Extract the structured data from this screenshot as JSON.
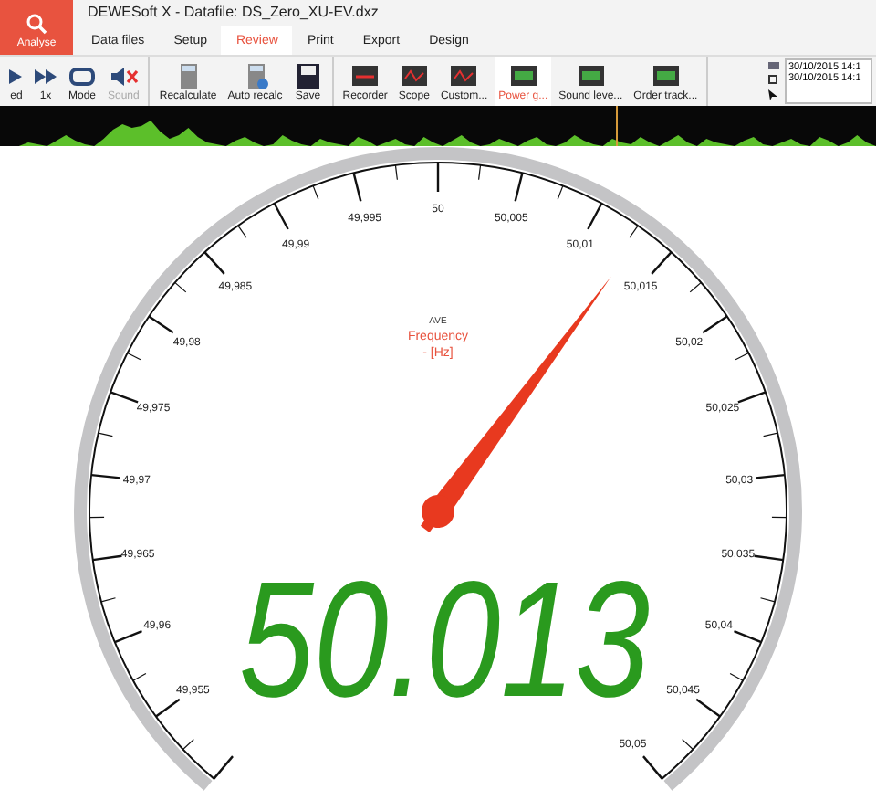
{
  "app": {
    "title": "DEWESoft X - Datafile: DS_Zero_XU-EV.dxz",
    "mode_button": "Analyse"
  },
  "tabs": [
    {
      "label": "Data files",
      "selected": false
    },
    {
      "label": "Setup",
      "selected": false
    },
    {
      "label": "Review",
      "selected": true
    },
    {
      "label": "Print",
      "selected": false
    },
    {
      "label": "Export",
      "selected": false
    },
    {
      "label": "Design",
      "selected": false
    }
  ],
  "toolbar": [
    [
      {
        "kind": "play",
        "label": "ed",
        "disabled": false,
        "selected": false
      },
      {
        "kind": "speed",
        "label": "1x",
        "disabled": false,
        "selected": false
      },
      {
        "kind": "mode",
        "label": "Mode",
        "disabled": false,
        "selected": false
      },
      {
        "kind": "sound",
        "label": "Sound",
        "disabled": true,
        "selected": false
      }
    ],
    [
      {
        "kind": "calc",
        "label": "Recalculate",
        "disabled": false,
        "selected": false
      },
      {
        "kind": "autocalc",
        "label": "Auto recalc",
        "disabled": false,
        "selected": false
      },
      {
        "kind": "save",
        "label": "Save",
        "disabled": false,
        "selected": false
      }
    ],
    [
      {
        "kind": "recorder",
        "label": "Recorder",
        "disabled": false,
        "selected": false
      },
      {
        "kind": "scope",
        "label": "Scope",
        "disabled": false,
        "selected": false
      },
      {
        "kind": "custom",
        "label": "Custom...",
        "disabled": false,
        "selected": false
      },
      {
        "kind": "display",
        "label": "Power g...",
        "disabled": false,
        "selected": true
      },
      {
        "kind": "display",
        "label": "Sound leve...",
        "disabled": false,
        "selected": false
      },
      {
        "kind": "display",
        "label": "Order track...",
        "disabled": false,
        "selected": false
      }
    ]
  ],
  "timestamps": [
    "30/10/2015 14:1",
    "30/10/2015 14:1"
  ],
  "gauge": {
    "quantity_prefix": "AVE",
    "quantity": "Frequency",
    "unit": "- [Hz]",
    "level": 0.63,
    "reading": "50.013",
    "scale_labels": [
      "49,955",
      "49,96",
      "49,965",
      "49,97",
      "49,975",
      "49,98",
      "49,985",
      "49,99",
      "49,995",
      "50",
      "50,005",
      "50,01",
      "50,015",
      "50,02",
      "50,025",
      "50,03",
      "50,035",
      "50,04",
      "50,045",
      "50,05"
    ]
  }
}
